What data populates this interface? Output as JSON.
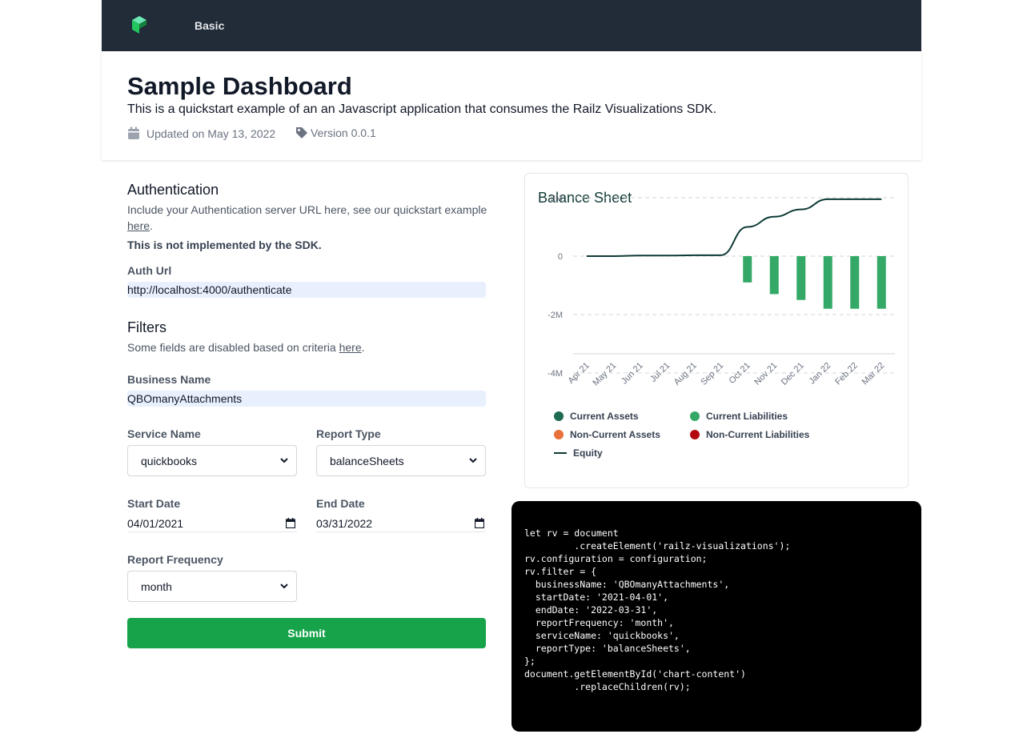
{
  "nav": {
    "brand_icon": "railz-logo-icon",
    "links": [
      "Basic"
    ]
  },
  "header": {
    "title": "Sample Dashboard",
    "description": "This is a quickstart example of an an Javascript application that consumes the Railz Visualizations SDK.",
    "updated": "Updated on May 13, 2022",
    "version": "Version 0.0.1"
  },
  "auth": {
    "title": "Authentication",
    "hint_prefix": "Include your Authentication server URL here, see our quickstart example",
    "hint_link": "here",
    "hint_suffix": ".",
    "note": "This is not implemented by the SDK.",
    "url_label": "Auth Url",
    "url_value": "http://localhost:4000/authenticate"
  },
  "filters": {
    "title": "Filters",
    "hint_prefix": "Some fields are disabled based on criteria",
    "hint_link": "here",
    "hint_suffix": ".",
    "business_label": "Business Name",
    "business_value": "QBOmanyAttachments",
    "service_label": "Service Name",
    "service_value": "quickbooks",
    "report_type_label": "Report Type",
    "report_type_value": "balanceSheets",
    "start_label": "Start Date",
    "start_value": "04/01/2021",
    "end_label": "End Date",
    "end_value": "03/31/2022",
    "frequency_label": "Report Frequency",
    "frequency_value": "month",
    "submit_label": "Submit"
  },
  "chart_data": {
    "type": "bar",
    "title": "Balance Sheet",
    "categories": [
      "Apr 21",
      "May 21",
      "Jun 21",
      "Jul 21",
      "Aug 21",
      "Sep 21",
      "Oct 21",
      "Nov 21",
      "Dec 21",
      "Jan 22",
      "Feb 22",
      "Mar 22"
    ],
    "yticks": [
      "2M",
      "0",
      "-2M",
      "-4M"
    ],
    "ytick_values": [
      2000000,
      0,
      -2000000,
      -4000000
    ],
    "ylim": [
      -6000000,
      2000000
    ],
    "grid": true,
    "legend_position": "bottom",
    "series": [
      {
        "name": "Current Assets",
        "type": "bar",
        "color": "#1e6b4f",
        "values": [
          0,
          0,
          0,
          0,
          0,
          0,
          0,
          0,
          0,
          0,
          0,
          0
        ]
      },
      {
        "name": "Current Liabilities",
        "type": "bar",
        "color": "#34a866",
        "values": [
          0,
          0,
          0,
          0,
          0,
          0,
          -900000,
          -1300000,
          -1500000,
          -1800000,
          -1800000,
          -1800000
        ]
      },
      {
        "name": "Non-Current Assets",
        "type": "bar",
        "color": "#e8703a",
        "values": [
          0,
          0,
          0,
          0,
          0,
          0,
          0,
          0,
          0,
          0,
          0,
          0
        ]
      },
      {
        "name": "Non-Current Liabilities",
        "type": "bar",
        "color": "#b3090f",
        "values": [
          0,
          0,
          0,
          0,
          0,
          0,
          0,
          0,
          0,
          0,
          0,
          0
        ]
      },
      {
        "name": "Equity",
        "type": "line",
        "color": "#0f3b36",
        "values": [
          0,
          0,
          20000,
          20000,
          30000,
          30000,
          1000000,
          1350000,
          1600000,
          1950000,
          1950000,
          1950000
        ]
      }
    ]
  },
  "code": {
    "snippet": "let rv = document\n         .createElement('railz-visualizations');\nrv.configuration = configuration;\nrv.filter = {\n  businessName: 'QBOmanyAttachments',\n  startDate: '2021-04-01',\n  endDate: '2022-03-31',\n  reportFrequency: 'month',\n  serviceName: 'quickbooks',\n  reportType: 'balanceSheets',\n};\ndocument.getElementById('chart-content')\n         .replaceChildren(rv);"
  }
}
